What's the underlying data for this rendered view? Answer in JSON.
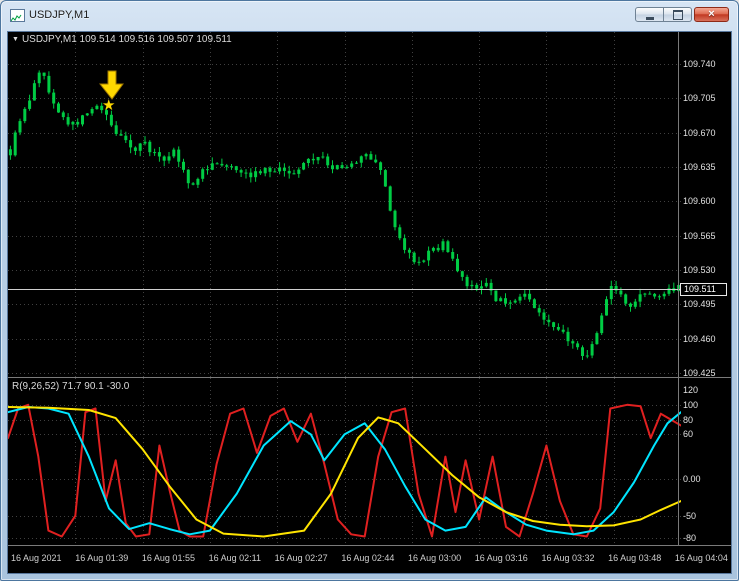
{
  "window": {
    "title": "USDJPY,M1",
    "controls": {
      "close_glyph": "×"
    }
  },
  "chart": {
    "header": {
      "dropdown_glyph": "▼",
      "text": "USDJPY,M1 109.514 109.516 109.507 109.511"
    },
    "price_axis_labels": [
      "109.740",
      "109.705",
      "109.670",
      "109.635",
      "109.600",
      "109.565",
      "109.530",
      "109.495",
      "109.460",
      "109.425"
    ],
    "bid_badge": "109.511",
    "annotations": [
      {
        "type": "arrow-down",
        "color": "#ffd800"
      },
      {
        "type": "star",
        "glyph": "★",
        "color": "#ffd800"
      }
    ]
  },
  "indicator": {
    "label": "R(9,26,52) 71.7 90.1 -30.0",
    "axis_labels": [
      "120",
      "100",
      "80",
      "60",
      "0.00",
      "-50",
      "-80"
    ]
  },
  "time_axis": [
    "16 Aug 2021",
    "16 Aug 01:39",
    "16 Aug 01:55",
    "16 Aug 02:11",
    "16 Aug 02:27",
    "16 Aug 02:44",
    "16 Aug 03:00",
    "16 Aug 03:16",
    "16 Aug 03:32",
    "16 Aug 03:48",
    "16 Aug 04:04"
  ],
  "colors": {
    "background": "#000000",
    "grid": "#404040",
    "candle": "#00cc44",
    "bid_line": "#cfcfcf",
    "axis_text": "#e2e2e2",
    "separator": "#7a7a7a"
  },
  "chart_data": {
    "type": "candlestick",
    "symbol": "USDJPY",
    "timeframe": "M1",
    "ohlc_header": {
      "open": 109.514,
      "high": 109.516,
      "low": 109.507,
      "close": 109.511
    },
    "bid": 109.511,
    "price_axis": {
      "min": 109.425,
      "max": 109.74,
      "step": 0.035
    },
    "price_anchors": [
      [
        0,
        109.65
      ],
      [
        0.008,
        109.668
      ],
      [
        0.02,
        109.69
      ],
      [
        0.033,
        109.712
      ],
      [
        0.045,
        109.738
      ],
      [
        0.052,
        109.722
      ],
      [
        0.062,
        109.7
      ],
      [
        0.075,
        109.688
      ],
      [
        0.09,
        109.678
      ],
      [
        0.105,
        109.682
      ],
      [
        0.118,
        109.692
      ],
      [
        0.13,
        109.7
      ],
      [
        0.142,
        109.688
      ],
      [
        0.155,
        109.672
      ],
      [
        0.17,
        109.662
      ],
      [
        0.185,
        109.653
      ],
      [
        0.2,
        109.66
      ],
      [
        0.215,
        109.648
      ],
      [
        0.228,
        109.642
      ],
      [
        0.245,
        109.654
      ],
      [
        0.258,
        109.632
      ],
      [
        0.272,
        109.614
      ],
      [
        0.285,
        109.628
      ],
      [
        0.3,
        109.64
      ],
      [
        0.33,
        109.638
      ],
      [
        0.36,
        109.628
      ],
      [
        0.39,
        109.633
      ],
      [
        0.42,
        109.628
      ],
      [
        0.445,
        109.64
      ],
      [
        0.465,
        109.646
      ],
      [
        0.485,
        109.633
      ],
      [
        0.51,
        109.637
      ],
      [
        0.535,
        109.648
      ],
      [
        0.552,
        109.641
      ],
      [
        0.562,
        109.61
      ],
      [
        0.575,
        109.572
      ],
      [
        0.59,
        109.55
      ],
      [
        0.61,
        109.538
      ],
      [
        0.63,
        109.548
      ],
      [
        0.648,
        109.558
      ],
      [
        0.662,
        109.542
      ],
      [
        0.675,
        109.52
      ],
      [
        0.693,
        109.51
      ],
      [
        0.71,
        109.518
      ],
      [
        0.728,
        109.5
      ],
      [
        0.748,
        109.495
      ],
      [
        0.768,
        109.503
      ],
      [
        0.788,
        109.49
      ],
      [
        0.808,
        109.477
      ],
      [
        0.828,
        109.464
      ],
      [
        0.85,
        109.448
      ],
      [
        0.862,
        109.442
      ],
      [
        0.875,
        109.462
      ],
      [
        0.888,
        109.492
      ],
      [
        0.9,
        109.515
      ],
      [
        0.912,
        109.507
      ],
      [
        0.925,
        109.489
      ],
      [
        0.94,
        109.5
      ],
      [
        0.953,
        109.511
      ],
      [
        0.967,
        109.503
      ],
      [
        0.982,
        109.51
      ],
      [
        1,
        109.511
      ]
    ],
    "indicator": {
      "name": "R(9,26,52)",
      "current_values": [
        71.7,
        90.1,
        -30.0
      ],
      "range": [
        -80,
        120
      ],
      "grid_levels": [
        100,
        80,
        60,
        0,
        -50,
        -80
      ],
      "series": [
        {
          "name": "red",
          "color": "#e02020",
          "points": [
            [
              0,
              55
            ],
            [
              0.015,
              95
            ],
            [
              0.03,
              100
            ],
            [
              0.045,
              30
            ],
            [
              0.06,
              -70
            ],
            [
              0.08,
              -78
            ],
            [
              0.1,
              -50
            ],
            [
              0.115,
              90
            ],
            [
              0.13,
              95
            ],
            [
              0.145,
              -30
            ],
            [
              0.16,
              25
            ],
            [
              0.175,
              -60
            ],
            [
              0.19,
              -78
            ],
            [
              0.21,
              -75
            ],
            [
              0.225,
              45
            ],
            [
              0.24,
              -15
            ],
            [
              0.255,
              -70
            ],
            [
              0.27,
              -78
            ],
            [
              0.29,
              -78
            ],
            [
              0.31,
              20
            ],
            [
              0.33,
              88
            ],
            [
              0.35,
              95
            ],
            [
              0.37,
              35
            ],
            [
              0.39,
              85
            ],
            [
              0.41,
              95
            ],
            [
              0.43,
              50
            ],
            [
              0.45,
              88
            ],
            [
              0.47,
              20
            ],
            [
              0.49,
              -55
            ],
            [
              0.51,
              -75
            ],
            [
              0.53,
              -78
            ],
            [
              0.55,
              30
            ],
            [
              0.57,
              90
            ],
            [
              0.59,
              95
            ],
            [
              0.61,
              -20
            ],
            [
              0.63,
              -78
            ],
            [
              0.65,
              30
            ],
            [
              0.665,
              -45
            ],
            [
              0.68,
              25
            ],
            [
              0.7,
              -55
            ],
            [
              0.72,
              30
            ],
            [
              0.74,
              -65
            ],
            [
              0.76,
              -78
            ],
            [
              0.78,
              -20
            ],
            [
              0.8,
              45
            ],
            [
              0.82,
              -30
            ],
            [
              0.84,
              -75
            ],
            [
              0.86,
              -78
            ],
            [
              0.88,
              -40
            ],
            [
              0.895,
              95
            ],
            [
              0.92,
              100
            ],
            [
              0.94,
              98
            ],
            [
              0.955,
              55
            ],
            [
              0.97,
              88
            ],
            [
              0.985,
              80
            ],
            [
              1,
              72
            ]
          ]
        },
        {
          "name": "aqua",
          "color": "#00e5ff",
          "points": [
            [
              0,
              90
            ],
            [
              0.03,
              97
            ],
            [
              0.06,
              95
            ],
            [
              0.09,
              88
            ],
            [
              0.12,
              30
            ],
            [
              0.15,
              -40
            ],
            [
              0.18,
              -68
            ],
            [
              0.21,
              -60
            ],
            [
              0.24,
              -68
            ],
            [
              0.27,
              -75
            ],
            [
              0.3,
              -70
            ],
            [
              0.34,
              -20
            ],
            [
              0.38,
              45
            ],
            [
              0.42,
              78
            ],
            [
              0.45,
              60
            ],
            [
              0.47,
              25
            ],
            [
              0.5,
              60
            ],
            [
              0.53,
              75
            ],
            [
              0.56,
              40
            ],
            [
              0.59,
              -10
            ],
            [
              0.62,
              -55
            ],
            [
              0.65,
              -70
            ],
            [
              0.68,
              -65
            ],
            [
              0.71,
              -25
            ],
            [
              0.74,
              -45
            ],
            [
              0.77,
              -62
            ],
            [
              0.8,
              -70
            ],
            [
              0.84,
              -75
            ],
            [
              0.87,
              -70
            ],
            [
              0.9,
              -45
            ],
            [
              0.93,
              -5
            ],
            [
              0.96,
              45
            ],
            [
              0.98,
              75
            ],
            [
              1,
              90
            ]
          ]
        },
        {
          "name": "yellow",
          "color": "#ffe400",
          "points": [
            [
              0,
              97
            ],
            [
              0.06,
              96
            ],
            [
              0.12,
              93
            ],
            [
              0.16,
              82
            ],
            [
              0.2,
              40
            ],
            [
              0.24,
              -10
            ],
            [
              0.28,
              -55
            ],
            [
              0.32,
              -74
            ],
            [
              0.38,
              -78
            ],
            [
              0.44,
              -70
            ],
            [
              0.48,
              -20
            ],
            [
              0.52,
              55
            ],
            [
              0.55,
              83
            ],
            [
              0.58,
              75
            ],
            [
              0.62,
              40
            ],
            [
              0.66,
              5
            ],
            [
              0.7,
              -25
            ],
            [
              0.74,
              -45
            ],
            [
              0.78,
              -57
            ],
            [
              0.82,
              -62
            ],
            [
              0.86,
              -64
            ],
            [
              0.9,
              -63
            ],
            [
              0.94,
              -55
            ],
            [
              0.97,
              -42
            ],
            [
              1,
              -30
            ]
          ]
        }
      ]
    }
  }
}
